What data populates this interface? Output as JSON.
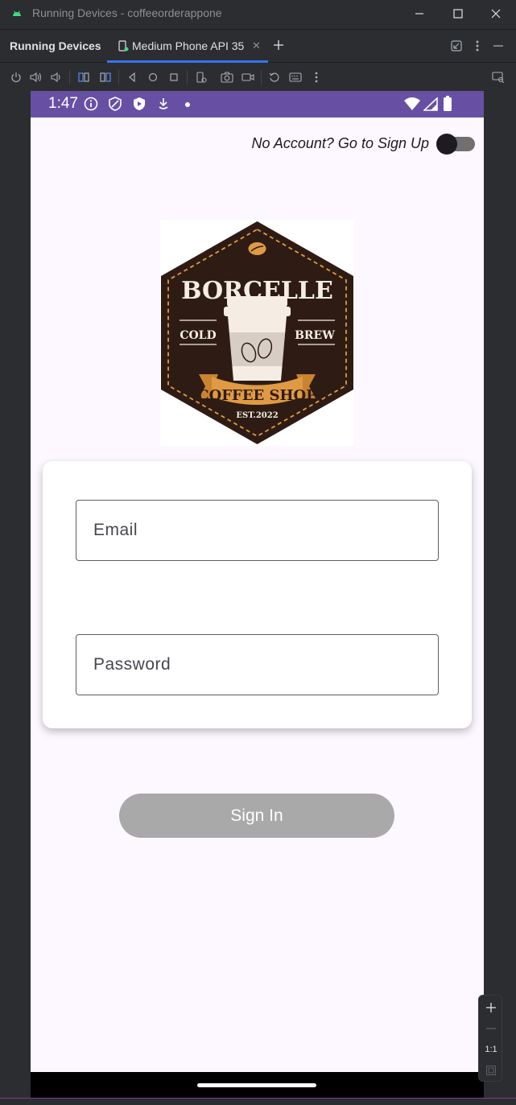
{
  "window": {
    "title": "Running Devices - coffeeorderappone"
  },
  "panel": {
    "label": "Running Devices"
  },
  "tabs": [
    {
      "label": "Medium Phone API 35",
      "active": true
    }
  ],
  "toolbar": {
    "icons": [
      "power-icon",
      "volume-up-icon",
      "volume-down-icon",
      "rotate-left-icon",
      "rotate-right-icon",
      "back-icon",
      "home-icon",
      "overview-icon",
      "device-settings-icon",
      "screenshot-icon",
      "screen-record-icon",
      "reset-icon",
      "keyboard-icon",
      "more-icon",
      "device-mirror-icon"
    ]
  },
  "status_bar": {
    "time": "1:47"
  },
  "app": {
    "signup_prompt": "No Account? Go to Sign Up",
    "toggle_on": false,
    "logo": {
      "brand": "BORCELLE",
      "left": "COLD",
      "right": "BREW",
      "banner": "COFFEE SHOP",
      "est": "EST.2022"
    },
    "email_label": "Email",
    "password_label": "Password",
    "signin_label": "Sign In"
  },
  "zoom": {
    "actual_size_label": "1:1"
  },
  "colors": {
    "status_bar": "#6750a4",
    "app_background": "#fdf7ff",
    "button_disabled": "#a9a9a9",
    "logo_brown": "#2e1c14",
    "logo_orange": "#e09a44"
  }
}
